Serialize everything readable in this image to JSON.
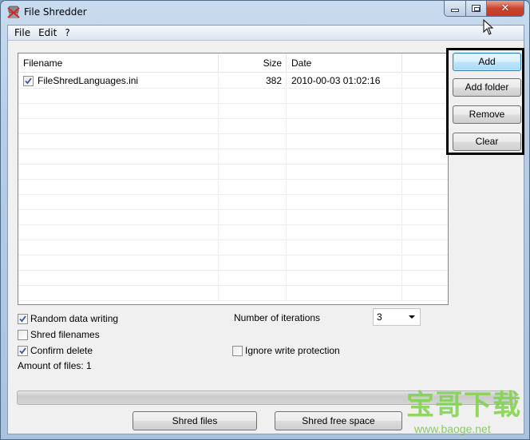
{
  "window": {
    "title": "File Shredder",
    "app_icon": "shredder-icon",
    "caption_buttons": [
      "minimize",
      "maximize",
      "close"
    ]
  },
  "menubar": {
    "items": [
      {
        "label": "File"
      },
      {
        "label": "Edit"
      },
      {
        "label": "?"
      }
    ]
  },
  "file_list": {
    "columns": [
      {
        "label": "Filename"
      },
      {
        "label": "Size"
      },
      {
        "label": "Date"
      },
      {
        "label": ""
      }
    ],
    "rows": [
      {
        "checked": true,
        "filename": "FileShredLanguages.ini",
        "size": "382",
        "date": "2010-00-03 01:02:16"
      }
    ],
    "empty_row_count": 14
  },
  "side_buttons": {
    "add": "Add",
    "add_folder": "Add folder",
    "remove": "Remove",
    "clear": "Clear"
  },
  "options": {
    "random_data_writing": {
      "label": "Random data writing",
      "checked": true
    },
    "shred_filenames": {
      "label": "Shred filenames",
      "checked": false
    },
    "confirm_delete": {
      "label": "Confirm delete",
      "checked": true
    },
    "ignore_write_protection": {
      "label": "Ignore write protection",
      "checked": false
    },
    "iterations_label": "Number of iterations",
    "iterations_value": "3"
  },
  "status": {
    "amount_of_files": "Amount of files: 1"
  },
  "progress": {
    "value_percent": 0
  },
  "bottom_buttons": {
    "shred_files": "Shred files",
    "shred_free_space": "Shred free space"
  },
  "watermark": {
    "text": "宝哥下载",
    "url": "www.baoge.net"
  }
}
